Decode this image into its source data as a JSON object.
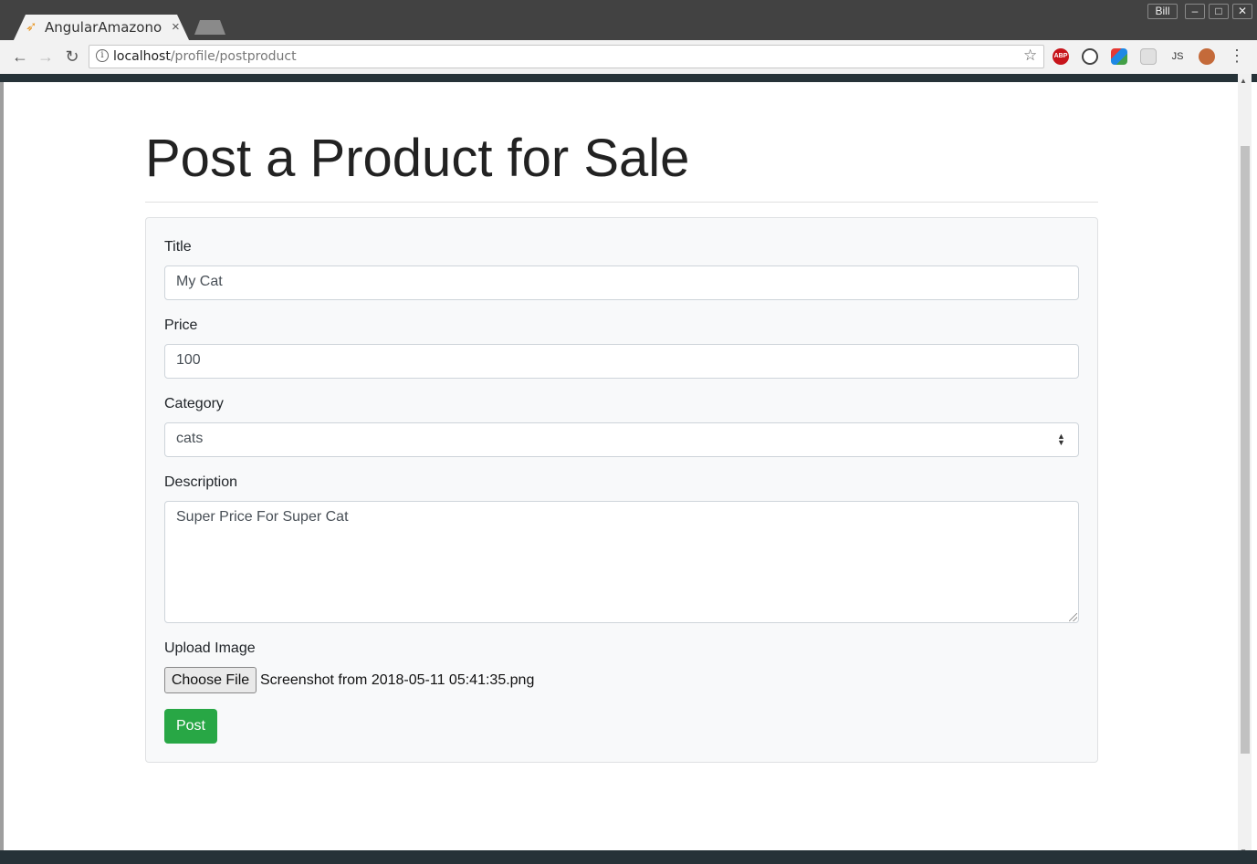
{
  "browser": {
    "tab_title": "AngularAmazono",
    "tab_close": "×",
    "user": "Bill",
    "win_minimize": "–",
    "win_maximize": "□",
    "win_close": "✕",
    "url_host": "localhost",
    "url_path": "/profile/postproduct",
    "abp_label": "ABP",
    "ext5_label": "JS"
  },
  "page": {
    "heading": "Post a Product for Sale",
    "form": {
      "title_label": "Title",
      "title_value": "My Cat",
      "price_label": "Price",
      "price_value": "100",
      "category_label": "Category",
      "category_value": "cats",
      "description_label": "Description",
      "description_value": "Super Price For Super Cat",
      "upload_label": "Upload Image",
      "file_button": "Choose File",
      "file_name": "Screenshot from 2018-05-11 05:41:35.png",
      "submit_label": "Post"
    }
  },
  "colors": {
    "primary_button": "#28a745",
    "navbar": "#263238"
  }
}
